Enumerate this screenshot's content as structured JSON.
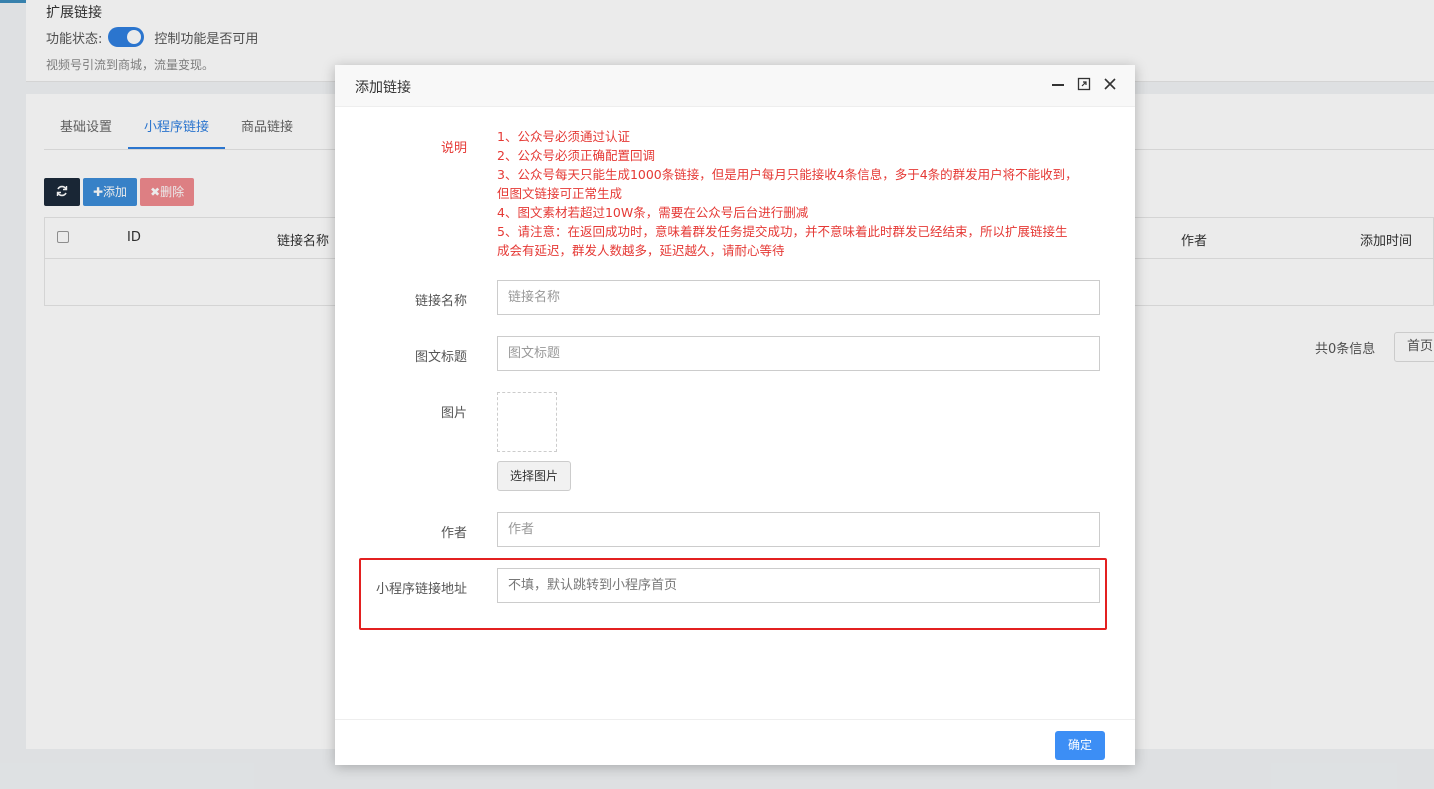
{
  "page": {
    "section_title": "扩展链接",
    "status_label": "功能状态:",
    "toggle_hint": "控制功能是否可用",
    "description": "视频号引流到商城，流量变现。"
  },
  "tabs": [
    {
      "label": "基础设置"
    },
    {
      "label": "小程序链接"
    },
    {
      "label": "商品链接"
    }
  ],
  "toolbar": {
    "refresh_icon": "refresh-icon",
    "add_label": "✚添加",
    "delete_label": "✖删除"
  },
  "table": {
    "columns": [
      "ID",
      "链接名称",
      "作者",
      "添加时间"
    ]
  },
  "pager": {
    "info": "共0条信息",
    "first": "首页"
  },
  "modal": {
    "title": "添加链接",
    "notice_label": "说明",
    "notice_lines": [
      "1、公众号必须通过认证",
      "2、公众号必须正确配置回调",
      "3、公众号每天只能生成1000条链接，但是用户每月只能接收4条信息，多于4条的群发用户将不能收到，",
      "但图文链接可正常生成",
      "4、图文素材若超过10W条，需要在公众号后台进行删减",
      "5、请注意：在返回成功时，意味着群发任务提交成功，并不意味着此时群发已经结束，所以扩展链接生",
      "成会有延迟，群发人数越多，延迟越久，请耐心等待"
    ],
    "fields": {
      "link_name_label": "链接名称",
      "link_name_placeholder": "链接名称",
      "article_title_label": "图文标题",
      "article_title_placeholder": "图文标题",
      "image_label": "图片",
      "choose_image": "选择图片",
      "author_label": "作者",
      "author_placeholder": "作者",
      "miniapp_url_label": "小程序链接地址",
      "miniapp_url_placeholder": "不填，默认跳转到小程序首页"
    },
    "confirm": "确定"
  },
  "colors": {
    "accent": "#2f7fe0",
    "notice": "#e53935",
    "highlight": "#e32020"
  }
}
